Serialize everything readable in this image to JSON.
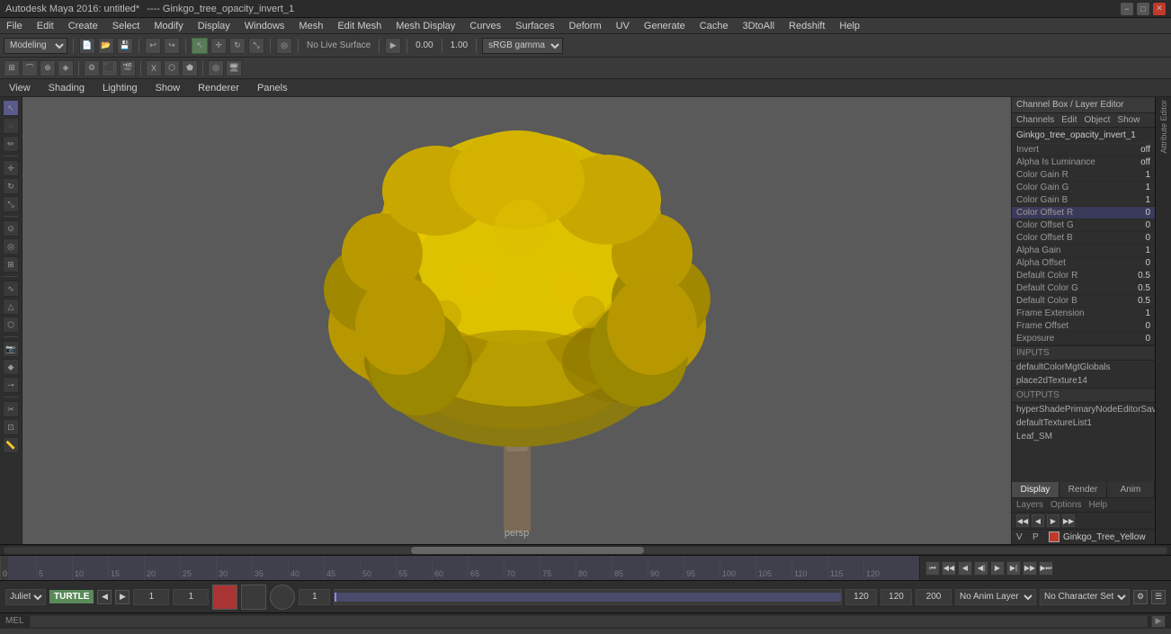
{
  "titleBar": {
    "appName": "Autodesk Maya 2016: untitled*",
    "fileSuffix": "---- Ginkgo_tree_opacity_invert_1",
    "winMin": "−",
    "winMax": "□",
    "winClose": "✕"
  },
  "menuBar": {
    "items": [
      "File",
      "Edit",
      "Create",
      "Select",
      "Modify",
      "Display",
      "Windows",
      "Mesh",
      "Edit Mesh",
      "Mesh Display",
      "Curves",
      "Surfaces",
      "Deform",
      "UV",
      "Generate",
      "Cache",
      "3DtoAll",
      "Redshift",
      "Help"
    ]
  },
  "toolbar": {
    "modeSelect": "Modeling",
    "noLiveLabel": "No Live Surface",
    "valueA": "0.00",
    "valueB": "1.00",
    "colorSpace": "sRGB gamma"
  },
  "viewTabs": {
    "items": [
      "View",
      "Shading",
      "Lighting",
      "Show",
      "Renderer",
      "Panels"
    ]
  },
  "viewport": {
    "label": "persp",
    "bgColor": "#5a5a5a"
  },
  "channelBox": {
    "title": "Channel Box / Layer Editor",
    "menuItems": [
      "Channels",
      "Edit",
      "Object",
      "Show"
    ],
    "nodeName": "Ginkgo_tree_opacity_invert_1",
    "channels": [
      {
        "name": "Invert",
        "value": "off",
        "highlight": false
      },
      {
        "name": "Alpha Is Luminance",
        "value": "off",
        "highlight": false
      },
      {
        "name": "Color Gain R",
        "value": "1",
        "highlight": false
      },
      {
        "name": "Color Gain G",
        "value": "1",
        "highlight": false
      },
      {
        "name": "Color Gain B",
        "value": "1",
        "highlight": false
      },
      {
        "name": "Color Offset R",
        "value": "0",
        "highlight": true
      },
      {
        "name": "Color Offset G",
        "value": "0",
        "highlight": false
      },
      {
        "name": "Color Offset B",
        "value": "0",
        "highlight": false
      },
      {
        "name": "Alpha Gain",
        "value": "1",
        "highlight": false
      },
      {
        "name": "Alpha Offset",
        "value": "0",
        "highlight": false
      },
      {
        "name": "Default Color R",
        "value": "0.5",
        "highlight": false
      },
      {
        "name": "Default Color G",
        "value": "0.5",
        "highlight": false
      },
      {
        "name": "Default Color B",
        "value": "0.5",
        "highlight": false
      },
      {
        "name": "Frame Extension",
        "value": "1",
        "highlight": false
      },
      {
        "name": "Frame Offset",
        "value": "0",
        "highlight": false
      },
      {
        "name": "Exposure",
        "value": "0",
        "highlight": false
      }
    ],
    "inputsLabel": "INPUTS",
    "inputItems": [
      "defaultColorMgtGlobals",
      "place2dTexture14"
    ],
    "outputsLabel": "OUTPUTS",
    "outputItems": [
      "hyperShadePrimaryNodeEditorSave...",
      "defaultTextureList1",
      "Leaf_SM"
    ]
  },
  "displayTabs": {
    "items": [
      "Display",
      "Render",
      "Anim"
    ],
    "active": "Display"
  },
  "layerPanel": {
    "headers": [
      "Layers",
      "Options",
      "Help"
    ],
    "navIcons": [
      "◀◀",
      "◀",
      "▶",
      "▶▶"
    ],
    "layers": [
      {
        "v": "V",
        "p": "P",
        "color": "#c0392b",
        "name": "Ginkgo_Tree_Yellow"
      }
    ]
  },
  "attrStrip": {
    "labels": [
      "Attribute Editor"
    ]
  },
  "timeline": {
    "ticks": [
      "0",
      "5",
      "10",
      "15",
      "20",
      "25",
      "30",
      "35",
      "40",
      "45",
      "50",
      "55",
      "60",
      "65",
      "70",
      "75",
      "80",
      "85",
      "90",
      "95",
      "100",
      "105",
      "110",
      "115",
      "120"
    ],
    "startFrame": "1",
    "endFrame": "120",
    "rangeStart": "1",
    "rangeEnd": "200"
  },
  "playback": {
    "buttons": [
      "⏮",
      "◀◀",
      "◀",
      "◀|",
      "▶",
      "▶|",
      "▶▶",
      "▶⏭"
    ],
    "frameStart": "1",
    "frameEnd": "120"
  },
  "animBar": {
    "juliet": "Juliet",
    "turtle": "TURTLE",
    "frameValue": "1",
    "frameValue2": "1",
    "rangeStart": "1",
    "rangeEnd": "120",
    "totalEnd": "200",
    "noAnimLayer": "No Anim Layer",
    "noCharSet": "No Character Set"
  },
  "statusBar": {
    "label": "MEL"
  }
}
